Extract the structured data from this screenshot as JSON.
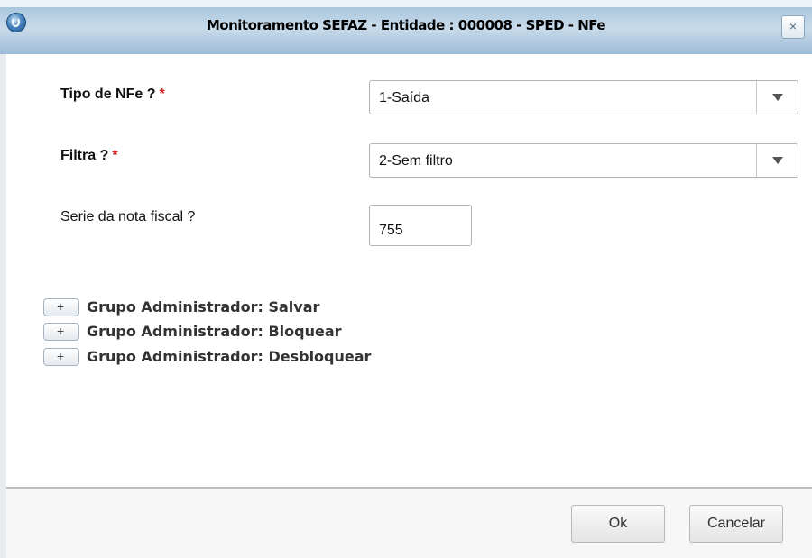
{
  "window": {
    "title": "Monitoramento SEFAZ - Entidade : 000008 - SPED - NFe",
    "close_label": "×",
    "app_icon": "app-logo-icon"
  },
  "form": {
    "tipo_nfe": {
      "label": "Tipo de NFe ?",
      "required_mark": "*",
      "value": "1-Saída",
      "dropdown_icon": "chevron-down-icon"
    },
    "filtra": {
      "label": "Filtra ?",
      "required_mark": "*",
      "value": "2-Sem filtro",
      "dropdown_icon": "chevron-down-icon"
    },
    "serie": {
      "label": "Serie da nota fiscal ?",
      "value": "755"
    }
  },
  "groups": [
    {
      "expander": "+",
      "label": "Grupo Administrador: Salvar"
    },
    {
      "expander": "+",
      "label": "Grupo Administrador: Bloquear"
    },
    {
      "expander": "+",
      "label": "Grupo Administrador: Desbloquear"
    }
  ],
  "footer": {
    "ok_label": "Ok",
    "cancel_label": "Cancelar"
  },
  "colors": {
    "required": "#d91c1c",
    "titlebar": "#a9c6de"
  }
}
